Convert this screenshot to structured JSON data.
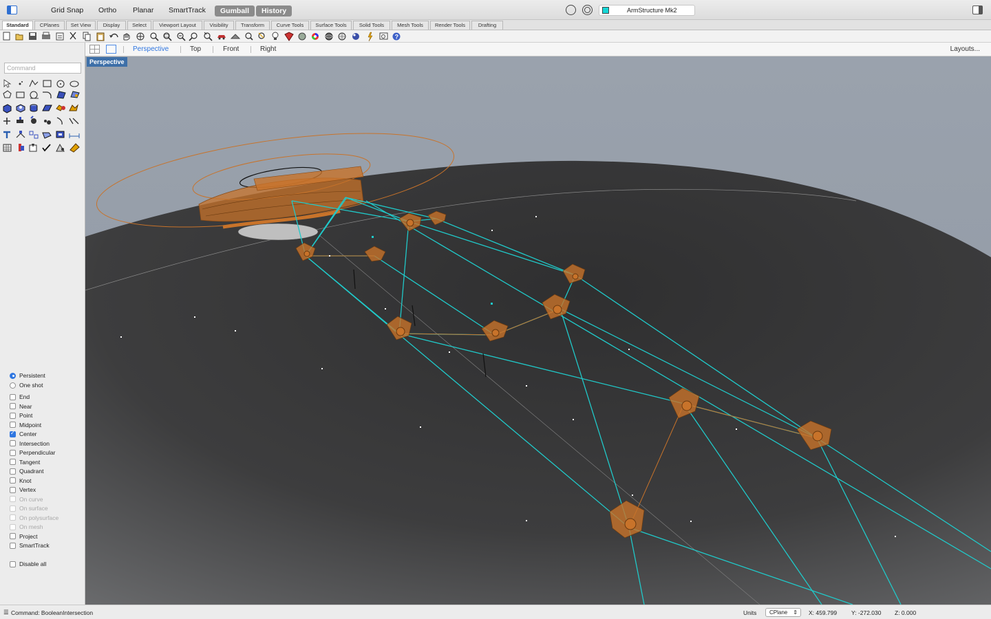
{
  "modes": [
    {
      "label": "Grid Snap",
      "on": false
    },
    {
      "label": "Ortho",
      "on": false
    },
    {
      "label": "Planar",
      "on": false
    },
    {
      "label": "SmartTrack",
      "on": false
    },
    {
      "label": "Gumball",
      "on": true
    },
    {
      "label": "History",
      "on": true
    }
  ],
  "document": {
    "layer_name": "ArmStructure Mk2",
    "layer_color": "#16d6d6"
  },
  "tabs": [
    "Standard",
    "CPlanes",
    "Set View",
    "Display",
    "Select",
    "Viewport Layout",
    "Visibility",
    "Transform",
    "Curve Tools",
    "Surface Tools",
    "Solid Tools",
    "Mesh Tools",
    "Render Tools",
    "Drafting"
  ],
  "active_tab": "Standard",
  "command": {
    "placeholder": "Command"
  },
  "osnap": {
    "persistent_label": "Persistent",
    "oneshot_label": "One shot",
    "items": [
      {
        "label": "End",
        "checked": false,
        "enabled": true
      },
      {
        "label": "Near",
        "checked": false,
        "enabled": true
      },
      {
        "label": "Point",
        "checked": false,
        "enabled": true
      },
      {
        "label": "Midpoint",
        "checked": false,
        "enabled": true
      },
      {
        "label": "Center",
        "checked": true,
        "enabled": true
      },
      {
        "label": "Intersection",
        "checked": false,
        "enabled": true
      },
      {
        "label": "Perpendicular",
        "checked": false,
        "enabled": true
      },
      {
        "label": "Tangent",
        "checked": false,
        "enabled": true
      },
      {
        "label": "Quadrant",
        "checked": false,
        "enabled": true
      },
      {
        "label": "Knot",
        "checked": false,
        "enabled": true
      },
      {
        "label": "Vertex",
        "checked": false,
        "enabled": true
      },
      {
        "label": "On curve",
        "checked": false,
        "enabled": false
      },
      {
        "label": "On surface",
        "checked": false,
        "enabled": false
      },
      {
        "label": "On polysurface",
        "checked": false,
        "enabled": false
      },
      {
        "label": "On mesh",
        "checked": false,
        "enabled": false
      },
      {
        "label": "Project",
        "checked": false,
        "enabled": true
      },
      {
        "label": "SmartTrack",
        "checked": false,
        "enabled": true
      }
    ],
    "disable_all": "Disable all"
  },
  "viewport_tabs": [
    "Perspective",
    "Top",
    "Front",
    "Right"
  ],
  "active_viewport": "Perspective",
  "layouts_label": "Layouts...",
  "viewport_label": "Perspective",
  "colors": {
    "wire": "#20c9c9",
    "object": "#c8732a",
    "ground": "#3a3a3a",
    "sky": "#98a0aa",
    "accent": "#2f76e0"
  },
  "status": {
    "command": "Command: BooleanIntersection",
    "units_label": "Units",
    "cplane": "CPlane",
    "x": "X: 459.799",
    "y": "Y: -272.030",
    "z": "Z: 0.000"
  }
}
